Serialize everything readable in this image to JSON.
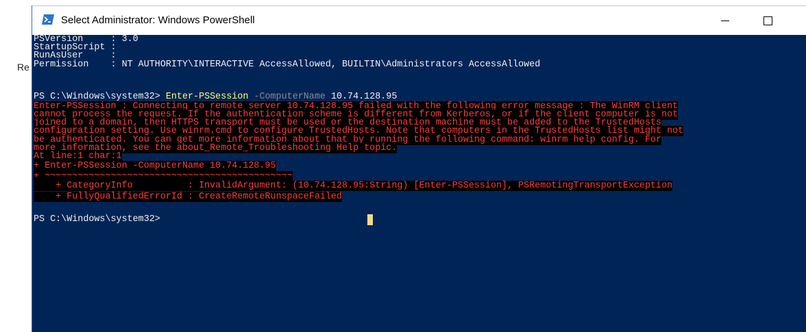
{
  "background": {
    "partial_label": "Re"
  },
  "window": {
    "title": "Select Administrator: Windows PowerShell",
    "buttons": {
      "minimize": "minimize",
      "maximize": "maximize",
      "close": "close"
    },
    "colors": {
      "console_bg": "#012456",
      "error_fg": "#ff3b3b",
      "error_bg": "#000000",
      "command": "#ffff66",
      "parameter": "#8a8a8a"
    }
  },
  "console": {
    "props": [
      "PSVersion     : 3.0",
      "StartupScript :",
      "RunAsUser     :",
      "Permission    : NT AUTHORITY\\INTERACTIVE AccessAllowed, BUILTIN\\Administrators AccessAllowed"
    ],
    "command_line": {
      "prompt": "PS C:\\Windows\\system32> ",
      "cmdlet": "Enter-PSSession",
      "param": " -ComputerName",
      "value": " 10.74.128.95"
    },
    "error_lines": [
      "Enter-PSSession : Connecting to remote server 10.74.128.95 failed with the following error message : The WinRM client",
      "cannot process the request. If the authentication scheme is different from Kerberos, or if the client computer is not",
      "joined to a domain, then HTTPS transport must be used or the destination machine must be added to the TrustedHosts",
      "configuration setting. Use winrm.cmd to configure TrustedHosts. Note that computers in the TrustedHosts list might not",
      "be authenticated. You can get more information about that by running the following command: winrm help config. For",
      "more information, see the about_Remote_Troubleshooting Help topic.",
      "At line:1 char:1",
      "+ Enter-PSSession -ComputerName 10.74.128.95",
      "+ ~~~~~~~~~~~~~~~~~~~~~~~~~~~~~~~~~~~~~~~~~~~~~",
      "    + CategoryInfo          : InvalidArgument: (10.74.128.95:String) [Enter-PSSession], PSRemotingTransportException",
      "    + FullyQualifiedErrorId : CreateRemoteRunspaceFailed"
    ],
    "final_prompt": "PS C:\\Windows\\system32>"
  }
}
